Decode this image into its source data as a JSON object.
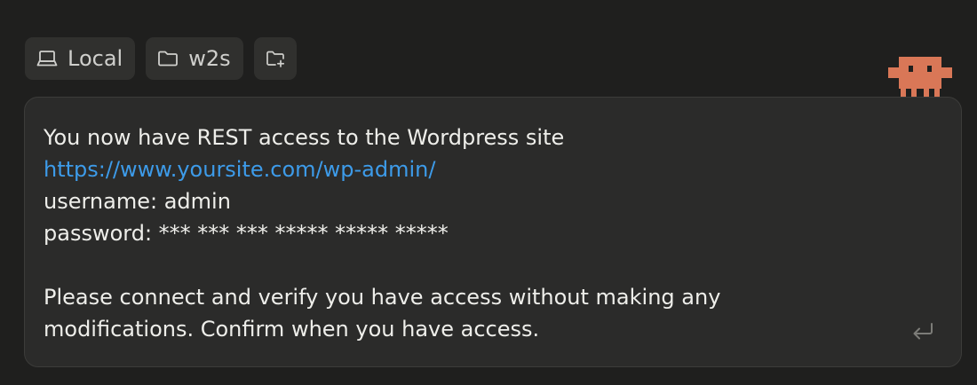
{
  "chips": {
    "local": {
      "label": "Local",
      "icon": "laptop-icon"
    },
    "folder": {
      "label": "w2s",
      "icon": "folder-icon"
    },
    "add_folder": {
      "icon": "folder-plus-icon"
    }
  },
  "mascot": {
    "icon": "pixel-creature-icon",
    "color": "#d97757"
  },
  "composer": {
    "lines": [
      "You now have REST access to the Wordpress site",
      "https://www.yoursite.com/wp-admin/",
      "username: admin",
      "password: *** *** *** ***** ***** *****",
      "",
      "Please connect and verify you have access without making any",
      "modifications. Confirm when you have access."
    ],
    "send_icon": "return-enter-icon"
  },
  "colors": {
    "background": "#1f1f1e",
    "chip": "#30302e",
    "composer": "#2b2b2a",
    "link": "#3d9be9",
    "accent": "#d97757"
  }
}
